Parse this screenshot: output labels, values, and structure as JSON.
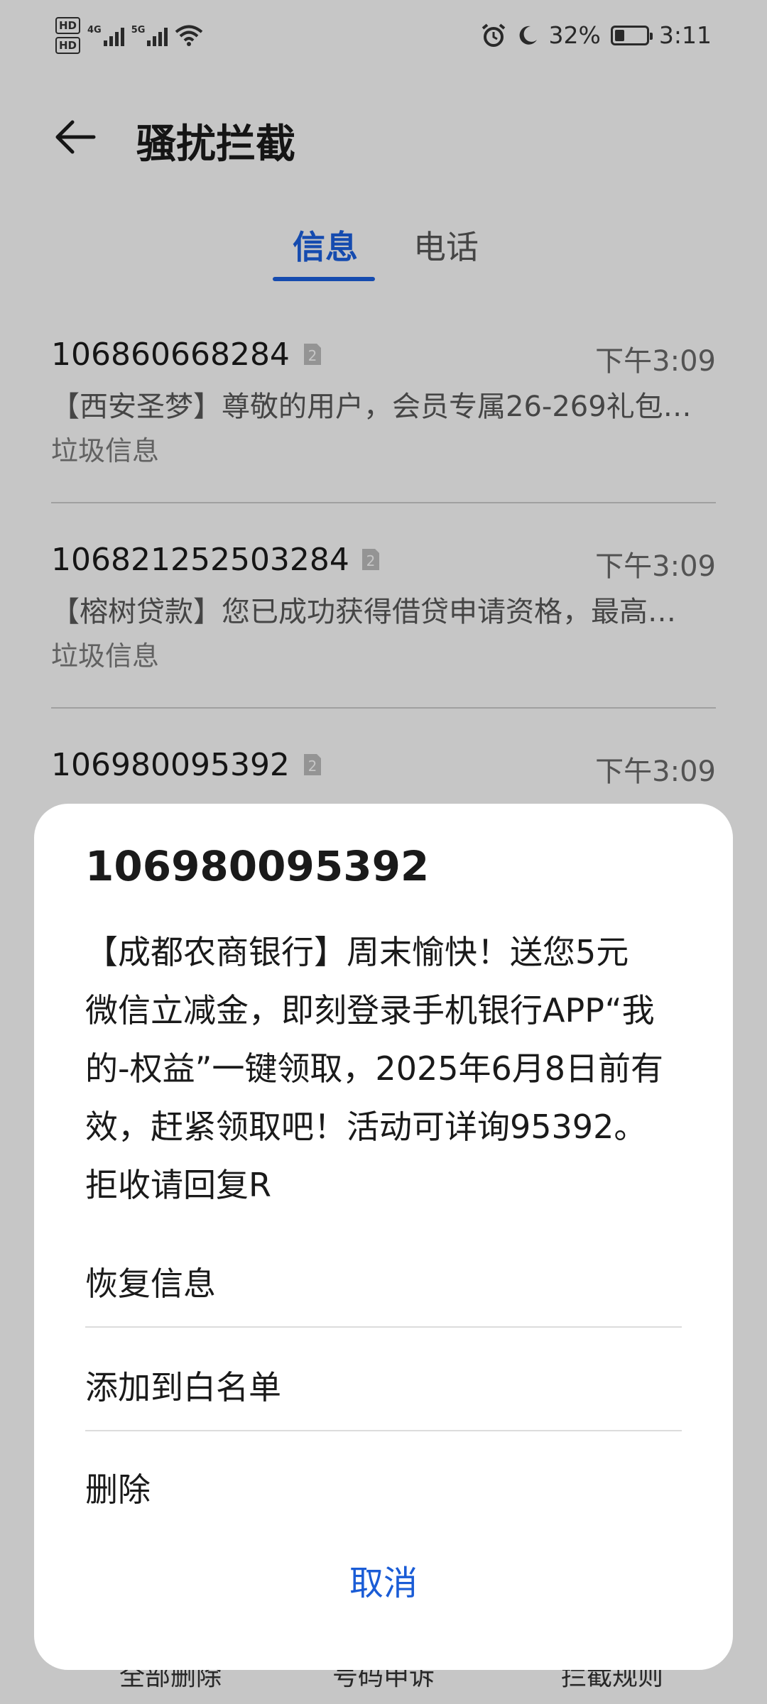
{
  "status_bar": {
    "hd1": "HD",
    "hd2": "HD",
    "net1": "4G",
    "net2": "5G",
    "battery_percent": "32%",
    "battery_level": 0.32,
    "time": "3:11"
  },
  "header": {
    "title": "骚扰拦截"
  },
  "tabs": {
    "messages": "信息",
    "calls": "电话",
    "active": "messages"
  },
  "messages": [
    {
      "number": "106860668284",
      "sim": "2",
      "time": "下午3:09",
      "preview": "【西安圣梦】尊敬的用户，会员专属26-269礼包…",
      "tag": "垃圾信息"
    },
    {
      "number": "106821252503284",
      "sim": "2",
      "time": "下午3:09",
      "preview": "【榕树贷款】您已成功获得借贷申请资格，最高…",
      "tag": "垃圾信息"
    },
    {
      "number": "106980095392",
      "sim": "2",
      "time": "下午3:09"
    }
  ],
  "bottom_actions": {
    "delete_all": "全部删除",
    "complain": "号码申诉",
    "rules": "拦截规则"
  },
  "dialog": {
    "title": "106980095392",
    "body_lines": [
      "【成都农商银行】周末愉快！送您5元",
      "微信立减金，即刻登录手机银行APP“我",
      "的-权益”一键领取，2025年6月8日前有",
      "效，赶紧领取吧！活动可详询95392。",
      "拒收请回复R"
    ],
    "options": {
      "restore": "恢复信息",
      "whitelist": "添加到白名单",
      "delete": "删除"
    },
    "cancel": "取消"
  },
  "colors": {
    "accent": "#1a5cd6"
  }
}
